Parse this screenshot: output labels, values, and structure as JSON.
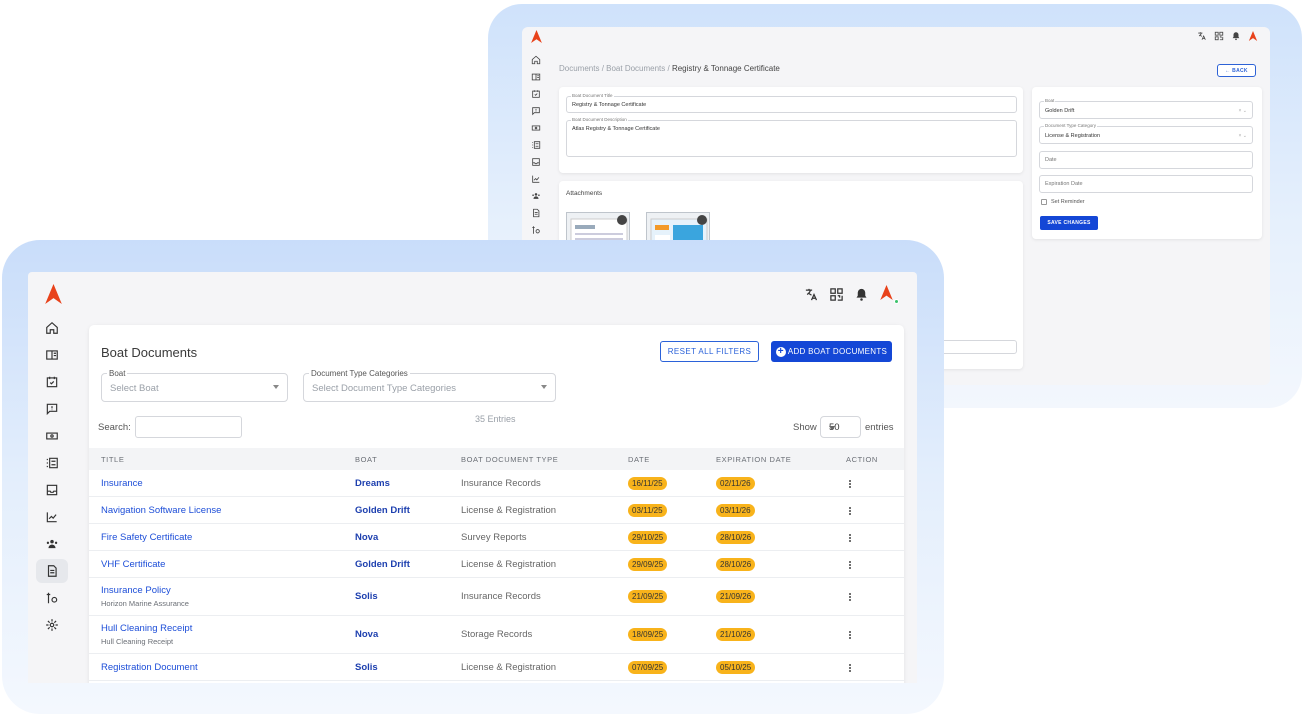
{
  "colors": {
    "accent": "#1447d6",
    "link": "#1d4ed8",
    "boat": "#1e40af",
    "badge": "#f8b31b",
    "logo": "#e8421b",
    "online": "#3bc26b"
  },
  "icons": {
    "top": [
      "translate-icon",
      "qr-code-icon",
      "bell-icon"
    ],
    "sidebar": [
      "home-icon",
      "id-card-icon",
      "calendar-check-icon",
      "message-alert-icon",
      "money-icon",
      "checklist-icon",
      "inbox-icon",
      "chart-line-icon",
      "users-icon",
      "documents-icon",
      "tools-icon",
      "gear-icon"
    ]
  },
  "detail": {
    "breadcrumb": {
      "root": "Documents",
      "sep1": " / ",
      "parent": "Boat Documents",
      "sep2": " / ",
      "current": "Registry & Tonnage Certificate"
    },
    "back_label": "← BACK",
    "title_label": "Boat Document Title",
    "title_value": "Registry & Tonnage Certificate",
    "description_label": "Boat Document Description",
    "description_value": "Atlas Registry & Tonnage Certificate",
    "attachments_label": "Attachments",
    "boat_label": "Boat",
    "boat_value": "Golden Drift",
    "type_label": "Document Type Category",
    "type_value": "License & Registration",
    "clear_arrow": "× ⌄",
    "date_placeholder": "Date",
    "expiration_placeholder": "Expiration Date",
    "reminder_label": "Set Reminder",
    "save_label": "SAVE CHANGES"
  },
  "list": {
    "title": "Boat Documents",
    "reset_label": "RESET ALL FILTERS",
    "add_label": "ADD BOAT DOCUMENTS",
    "boat_filter": {
      "label": "Boat",
      "placeholder": "Select Boat"
    },
    "type_filter": {
      "label": "Document Type Categories",
      "placeholder": "Select Document Type Categories"
    },
    "entries_count": "35 Entries",
    "search_label": "Search:",
    "show_label": "Show",
    "show_value": "50",
    "entries_label": "entries",
    "columns": [
      "TITLE",
      "BOAT",
      "BOAT DOCUMENT TYPE",
      "DATE",
      "EXPIRATION DATE",
      "ACTION"
    ],
    "rows": [
      {
        "title": "Insurance",
        "subtitle": "",
        "boat": "Dreams",
        "type": "Insurance Records",
        "date": "16/11/25",
        "expiration": "02/11/26"
      },
      {
        "title": "Navigation Software License",
        "subtitle": "",
        "boat": "Golden Drift",
        "type": "License & Registration",
        "date": "03/11/25",
        "expiration": "03/11/26"
      },
      {
        "title": "Fire Safety Certificate",
        "subtitle": "",
        "boat": "Nova",
        "type": "Survey Reports",
        "date": "29/10/25",
        "expiration": "28/10/26"
      },
      {
        "title": "VHF Certificate",
        "subtitle": "",
        "boat": "Golden Drift",
        "type": "License & Registration",
        "date": "29/09/25",
        "expiration": "28/10/26"
      },
      {
        "title": "Insurance Policy",
        "subtitle": "Horizon Marine Assurance",
        "boat": "Solis",
        "type": "Insurance Records",
        "date": "21/09/25",
        "expiration": "21/09/26"
      },
      {
        "title": "Hull Cleaning Receipt",
        "subtitle": "Hull Cleaning Receipt",
        "boat": "Nova",
        "type": "Storage Records",
        "date": "18/09/25",
        "expiration": "21/10/26"
      },
      {
        "title": "Registration Document",
        "subtitle": "",
        "boat": "Solis",
        "type": "License & Registration",
        "date": "07/09/25",
        "expiration": "05/10/25"
      }
    ]
  }
}
